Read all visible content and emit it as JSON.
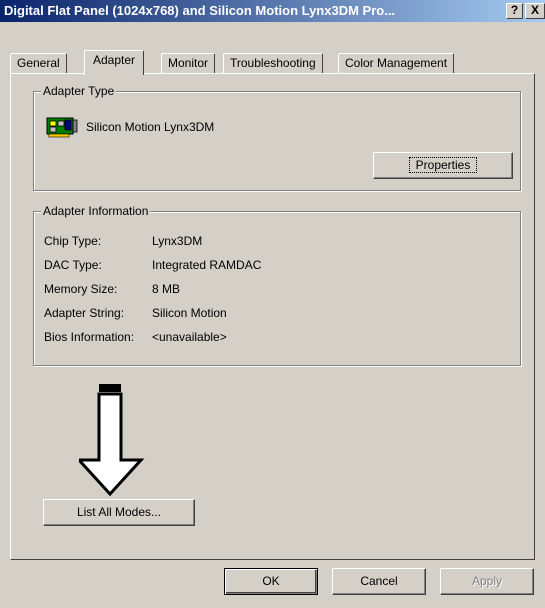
{
  "window": {
    "title": "Digital Flat Panel (1024x768) and Silicon Motion Lynx3DM Pro...",
    "help_label": "?",
    "close_label": "X"
  },
  "tabs": [
    {
      "label": "General",
      "active": false
    },
    {
      "label": "Adapter",
      "active": true
    },
    {
      "label": "Monitor",
      "active": false
    },
    {
      "label": "Troubleshooting",
      "active": false
    },
    {
      "label": "Color Management",
      "active": false
    }
  ],
  "adapter_type": {
    "group_label": "Adapter Type",
    "name": "Silicon Motion Lynx3DM",
    "icon": "display-adapter-icon",
    "properties_label": "Properties"
  },
  "adapter_info": {
    "group_label": "Adapter Information",
    "rows": [
      {
        "label": "Chip Type:",
        "value": "Lynx3DM"
      },
      {
        "label": "DAC Type:",
        "value": "Integrated RAMDAC"
      },
      {
        "label": "Memory Size:",
        "value": "8 MB"
      },
      {
        "label": "Adapter String:",
        "value": "Silicon Motion"
      },
      {
        "label": "Bios Information:",
        "value": "<unavailable>"
      }
    ]
  },
  "list_modes_label": "List All Modes...",
  "footer": {
    "ok_label": "OK",
    "cancel_label": "Cancel",
    "apply_label": "Apply"
  },
  "annotation": {
    "icon": "arrow-down-icon",
    "color": "#000000"
  },
  "colors": {
    "face": "#d4d0c8",
    "title_start": "#0a246a",
    "title_end": "#a6caf0"
  }
}
